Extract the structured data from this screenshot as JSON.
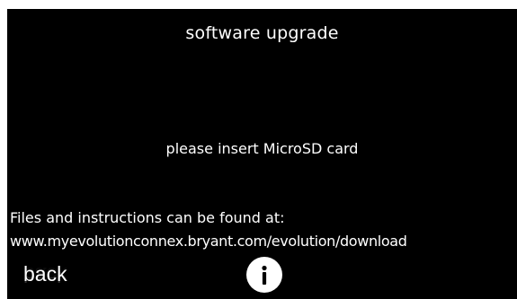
{
  "screen": {
    "title": "software upgrade",
    "message": "please insert MicroSD card",
    "info_text": "Files and instructions can be found at:",
    "url": "www.myevolutionconnex.bryant.com/evolution/download"
  },
  "controls": {
    "back_label": "back",
    "info_icon": "info-icon"
  },
  "colors": {
    "background": "#000000",
    "text": "#ffffff"
  }
}
